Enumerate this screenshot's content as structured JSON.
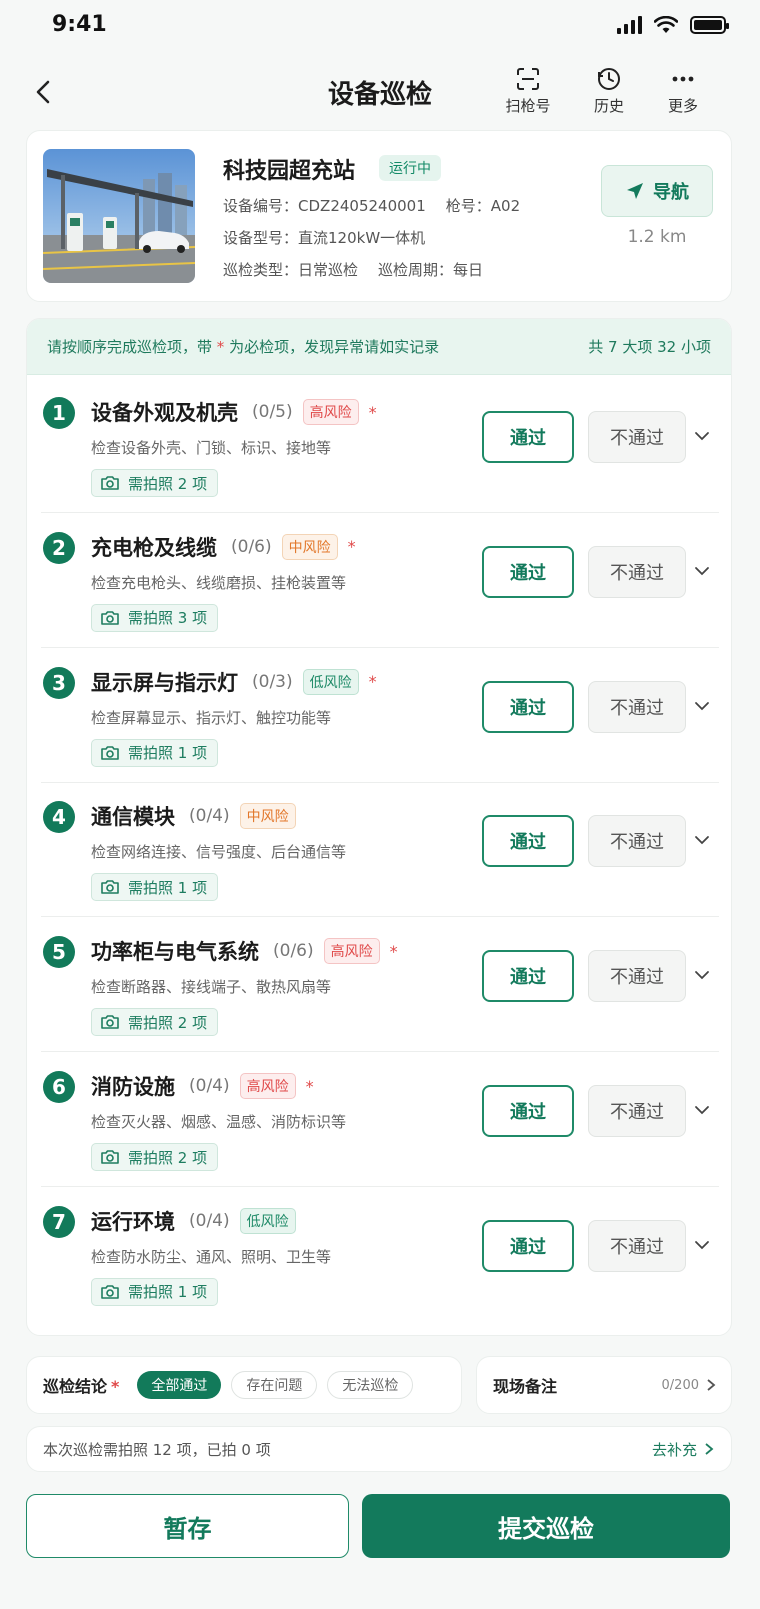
{
  "status": {
    "time": "9:41"
  },
  "header": {
    "title": "设备巡检",
    "actions": [
      {
        "label": "扫枪号",
        "icon": "scan-icon"
      },
      {
        "label": "历史",
        "icon": "history-icon"
      },
      {
        "label": "更多",
        "icon": "more-icon"
      }
    ]
  },
  "station": {
    "name": "科技园超充站",
    "status": "运行中",
    "device_no_label": "设备编号：",
    "device_no": "CDZ2405240001",
    "gun_label": "枪号：",
    "gun": "A02",
    "model_label": "设备型号：",
    "model": "直流120kW一体机",
    "type_label": "巡检类型：",
    "type": "日常巡检",
    "cycle_label": "巡检周期：",
    "cycle": "每日",
    "nav_label": "导航",
    "distance": "1.2 km"
  },
  "hint": {
    "pre": "请按顺序完成巡检项，带",
    "star": "*",
    "post": "为必检项，发现异常请如实记录",
    "summary": "共 7 大项 32 小项"
  },
  "items": [
    {
      "num": "1",
      "title": "设备外观及机壳",
      "count": "(0/5)",
      "risk": "高风险",
      "required": "*",
      "desc": "检查设备外壳、门锁、标识、接地等",
      "photo": "需拍照 2 项",
      "pass": "通过",
      "fail": "不通过"
    },
    {
      "num": "2",
      "title": "充电枪及线缆",
      "count": "(0/6)",
      "risk": "中风险",
      "required": "*",
      "desc": "检查充电枪头、线缆磨损、挂枪装置等",
      "photo": "需拍照 3 项",
      "pass": "通过",
      "fail": "不通过"
    },
    {
      "num": "3",
      "title": "显示屏与指示灯",
      "count": "(0/3)",
      "risk": "低风险",
      "required": "*",
      "desc": "检查屏幕显示、指示灯、触控功能等",
      "photo": "需拍照 1 项",
      "pass": "通过",
      "fail": "不通过"
    },
    {
      "num": "4",
      "title": "通信模块",
      "count": "(0/4)",
      "risk": "中风险",
      "required": "",
      "desc": "检查网络连接、信号强度、后台通信等",
      "photo": "需拍照 1 项",
      "pass": "通过",
      "fail": "不通过"
    },
    {
      "num": "5",
      "title": "功率柜与电气系统",
      "count": "(0/6)",
      "risk": "高风险",
      "required": "*",
      "desc": "检查断路器、接线端子、散热风扇等",
      "photo": "需拍照 2 项",
      "pass": "通过",
      "fail": "不通过"
    },
    {
      "num": "6",
      "title": "消防设施",
      "count": "(0/4)",
      "risk": "高风险",
      "required": "*",
      "desc": "检查灭火器、烟感、温感、消防标识等",
      "photo": "需拍照 2 项",
      "pass": "通过",
      "fail": "不通过"
    },
    {
      "num": "7",
      "title": "运行环境",
      "count": "(0/4)",
      "risk": "低风险",
      "required": "",
      "desc": "检查防水防尘、通风、照明、卫生等",
      "photo": "需拍照 1 项",
      "pass": "通过",
      "fail": "不通过"
    }
  ],
  "conclusion": {
    "label": "巡检结论",
    "star": "*",
    "options": [
      "全部通过",
      "存在问题",
      "无法巡检"
    ],
    "selected": "全部通过"
  },
  "remarks": {
    "label": "现场备注",
    "count": "0/200"
  },
  "photo_summary": {
    "text": "本次巡检需拍照 12 项，已拍 0 项",
    "link": "去补充"
  },
  "footer": {
    "save": "暂存",
    "submit": "提交巡检"
  },
  "colors": {
    "brand": "#137a5c",
    "high_risk": "#e04a4a",
    "mid_risk": "#e2772a",
    "low_risk": "#1e8a67"
  }
}
